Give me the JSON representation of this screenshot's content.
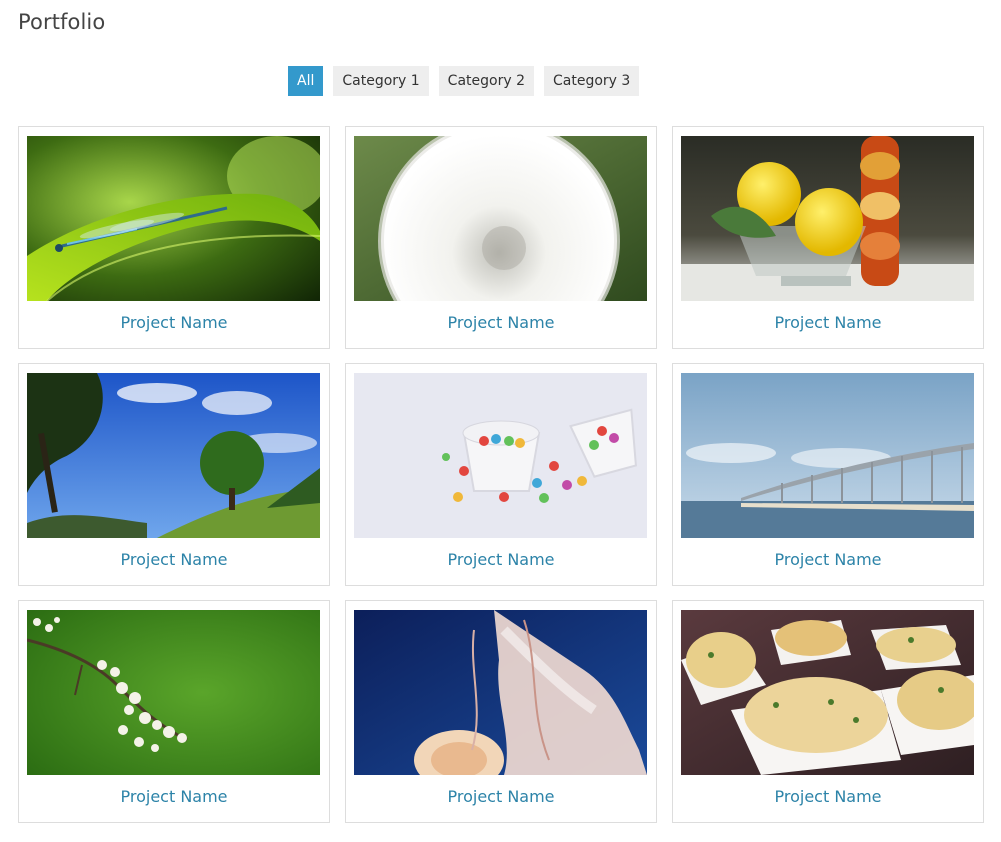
{
  "page": {
    "title": "Portfolio"
  },
  "filters": [
    {
      "label": "All",
      "active": true
    },
    {
      "label": "Category 1",
      "active": false
    },
    {
      "label": "Category 2",
      "active": false
    },
    {
      "label": "Category 3",
      "active": false
    }
  ],
  "projects": [
    {
      "name": "Project Name",
      "image": "dragonfly-on-leaf"
    },
    {
      "name": "Project Name",
      "image": "dandelion-seed-head"
    },
    {
      "name": "Project Name",
      "image": "lemons-in-glass-bowl"
    },
    {
      "name": "Project Name",
      "image": "tree-on-hill-blue-sky"
    },
    {
      "name": "Project Name",
      "image": "candy-eggs-baskets"
    },
    {
      "name": "Project Name",
      "image": "bridge-over-sea"
    },
    {
      "name": "Project Name",
      "image": "blossom-branch"
    },
    {
      "name": "Project Name",
      "image": "jellyfish"
    },
    {
      "name": "Project Name",
      "image": "pastries-in-paper-cups"
    }
  ],
  "colors": {
    "accent": "#3399cc",
    "link": "#2c83a8",
    "filter_bg": "#eeeeee",
    "border": "#dddddd"
  }
}
